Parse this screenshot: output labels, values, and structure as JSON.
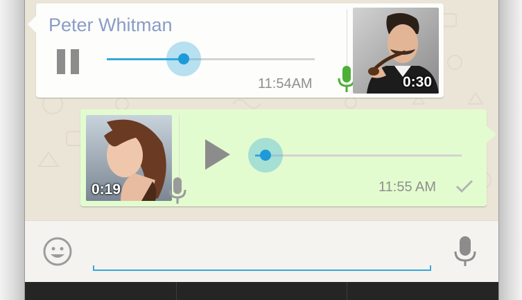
{
  "messages": {
    "incoming": {
      "sender": "Peter Whitman",
      "time": "11:54AM",
      "duration": "0:30",
      "progress": 0.37,
      "state": "playing",
      "icon": "pause-icon",
      "mic_color": "#4caf36"
    },
    "outgoing": {
      "time": "11:55 AM",
      "duration": "0:19",
      "progress": 0.05,
      "state": "paused",
      "icon": "play-icon",
      "status_icon": "check-icon",
      "mic_color": "#9a9a9a"
    }
  },
  "compose": {
    "emoji_icon": "emoji-icon",
    "mic_icon": "mic-icon",
    "placeholder": ""
  },
  "colors": {
    "accent": "#35a8dc",
    "sender_name": "#8a9cc6",
    "outgoing_bubble": "#e3fccf",
    "incoming_bubble": "#fdfdfb"
  }
}
